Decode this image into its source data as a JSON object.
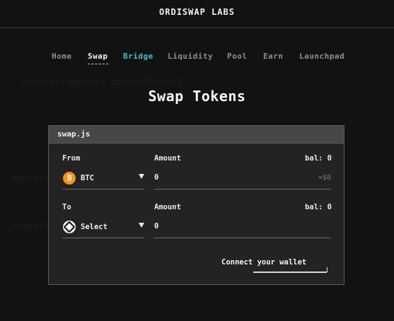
{
  "header": {
    "brand": "ORDISWAP LABS"
  },
  "nav": {
    "items": [
      {
        "label": "Home"
      },
      {
        "label": "Swap"
      },
      {
        "label": "Bridge"
      },
      {
        "label": "Liquidity"
      },
      {
        "label": "Pool"
      },
      {
        "label": "Earn"
      },
      {
        "label": "Launchpad"
      }
    ],
    "active": "Swap"
  },
  "main": {
    "title": "Swap Tokens"
  },
  "card": {
    "filename": "swap.js",
    "from": {
      "label": "From",
      "token": "BTC",
      "token_icon": "bitcoin-icon",
      "amount_label": "Amount",
      "balance": "bal: 0",
      "amount_value": "0",
      "usd_value": "≈$0"
    },
    "to": {
      "label": "To",
      "token": "Select",
      "token_icon": "token-placeholder-icon",
      "amount_label": "Amount",
      "balance": "bal: 0",
      "amount_value": "0"
    },
    "connect_label": "Connect your wallet"
  },
  "colors": {
    "background": "#121212",
    "accent": "#40c4c9",
    "btc": "#f7931a",
    "card": "#232323",
    "card_header": "#474747"
  }
}
